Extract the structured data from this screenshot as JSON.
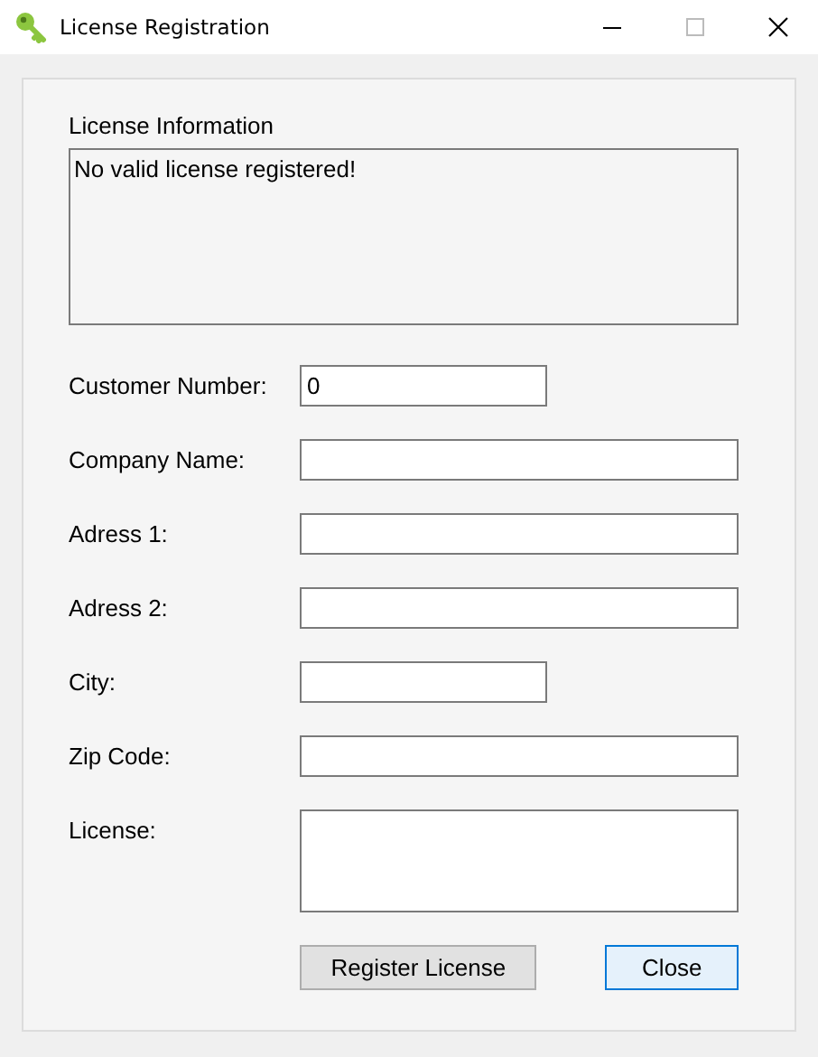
{
  "window": {
    "title": "License Registration"
  },
  "license_info": {
    "label": "License Information",
    "text": "No valid license registered!"
  },
  "fields": [
    {
      "label": "Customer Number:",
      "value": "0",
      "kind": "short"
    },
    {
      "label": "Company Name:",
      "kind": "long"
    },
    {
      "label": "Adress 1:",
      "kind": "long"
    },
    {
      "label": "Adress 2:",
      "kind": "long"
    },
    {
      "label": "City:",
      "kind": "short"
    },
    {
      "label": "Zip Code:",
      "kind": "long"
    },
    {
      "label": "License:",
      "kind": "multiline"
    }
  ],
  "buttons": [
    {
      "label": "Register License",
      "default": false
    },
    {
      "label": "Close",
      "default": true
    }
  ]
}
